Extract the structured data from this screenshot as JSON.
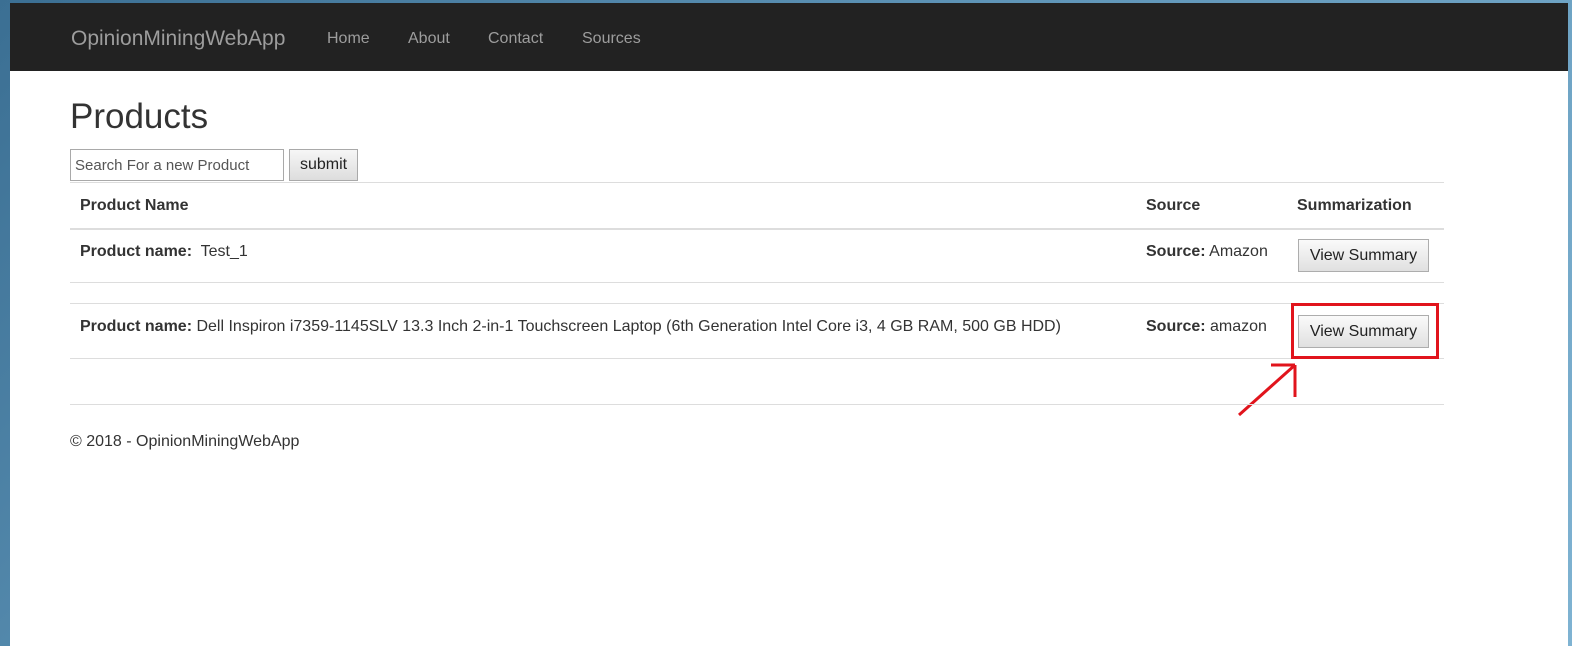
{
  "navbar": {
    "brand": "OpinionMiningWebApp",
    "links": [
      "Home",
      "About",
      "Contact",
      "Sources"
    ]
  },
  "page": {
    "title": "Products"
  },
  "search": {
    "placeholder": "Search For a new Product",
    "submit_label": "submit"
  },
  "table": {
    "headers": [
      "Product Name",
      "Source",
      "Summarization"
    ],
    "rows": [
      {
        "name_label": "Product name:",
        "name": "Test_1",
        "source_label": "Source:",
        "source": "Amazon",
        "action_label": "View Summary"
      },
      {
        "name_label": "Product name:",
        "name": "Dell Inspiron i7359-1145SLV 13.3 Inch 2-in-1 Touchscreen Laptop (6th Generation Intel Core i3, 4 GB RAM, 500 GB HDD)",
        "source_label": "Source:",
        "source": "amazon",
        "action_label": "View Summary"
      }
    ]
  },
  "annotation": {
    "color": "#e1141c"
  },
  "footer": {
    "text": "© 2018 - OpinionMiningWebApp"
  }
}
